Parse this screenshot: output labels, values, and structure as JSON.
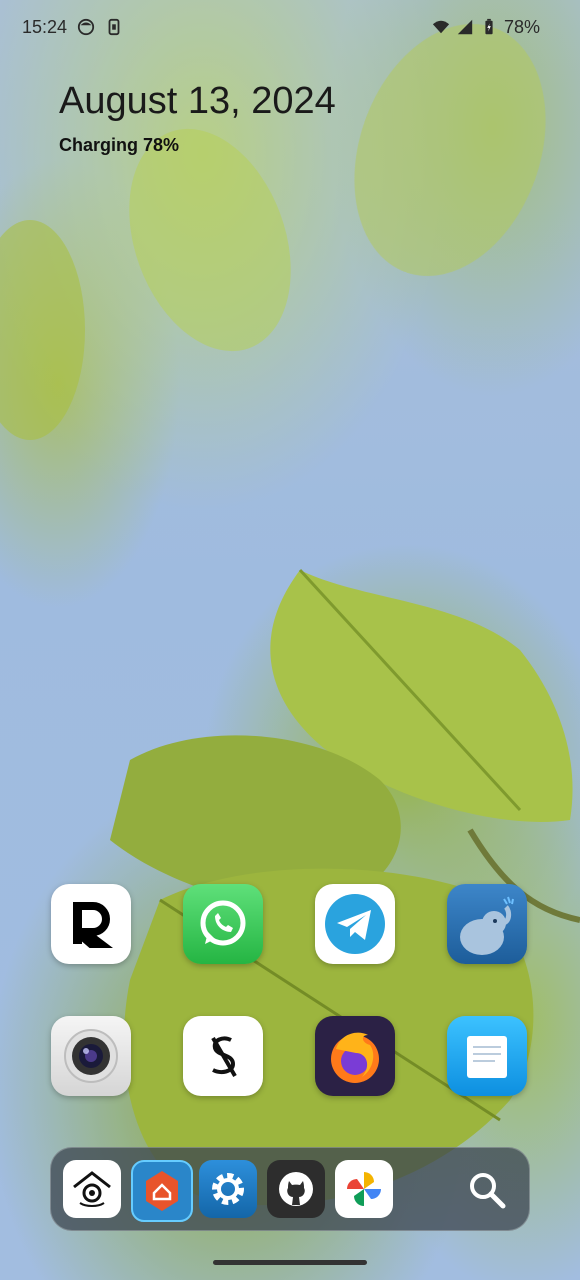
{
  "status_bar": {
    "time": "15:24",
    "battery_percent": "78%",
    "icons": [
      "notification-face-icon",
      "sim-card-icon",
      "wifi-icon",
      "cell-signal-icon",
      "battery-icon"
    ]
  },
  "widget": {
    "date": "August 13, 2024",
    "charging": "Charging 78%"
  },
  "apps_row1": [
    {
      "name": "revolut",
      "icon": "revolut-r-icon",
      "bg": "#ffffff"
    },
    {
      "name": "whatsapp",
      "icon": "whatsapp-icon",
      "bg": "#2dbd4d"
    },
    {
      "name": "telegram",
      "icon": "telegram-icon",
      "bg": "#ffffff"
    },
    {
      "name": "mastodon-elephant",
      "icon": "elephant-icon",
      "bg": "#2a6fb0"
    }
  ],
  "apps_row2": [
    {
      "name": "camera",
      "icon": "camera-icon",
      "bg": "#e8e8e8"
    },
    {
      "name": "s-app",
      "icon": "s-slash-icon",
      "bg": "#ffffff"
    },
    {
      "name": "firefox",
      "icon": "firefox-icon",
      "bg": "#2b2145"
    },
    {
      "name": "notes",
      "icon": "notes-icon",
      "bg": "#1fa8f2"
    }
  ],
  "dock": [
    {
      "name": "home-assistant",
      "icon": "home-eye-icon",
      "bg": "#ffffff"
    },
    {
      "name": "nova-launcher",
      "icon": "nova-home-icon",
      "bg": "#2a86c9"
    },
    {
      "name": "settings",
      "icon": "gear-icon",
      "bg": "#1e78c2"
    },
    {
      "name": "github",
      "icon": "github-icon",
      "bg": "#2d2d2d"
    },
    {
      "name": "photos",
      "icon": "photos-pinwheel-icon",
      "bg": "#ffffff"
    }
  ]
}
